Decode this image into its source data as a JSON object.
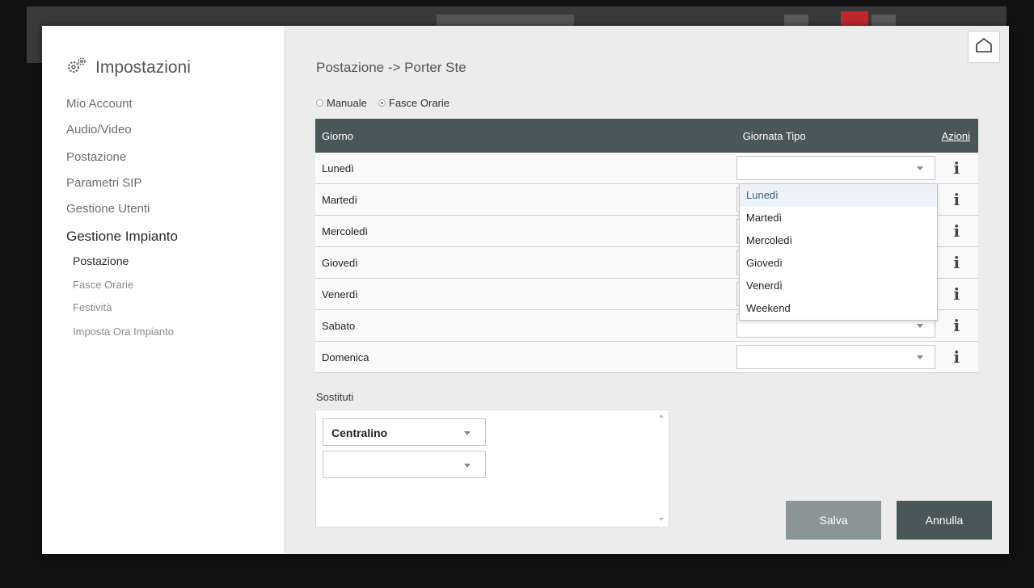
{
  "sidebar": {
    "title": "Impostazioni",
    "items": [
      {
        "label": "Mio Account"
      },
      {
        "label": "Audio/Video"
      },
      {
        "label": "Postazione"
      },
      {
        "label": "Parametri SIP"
      },
      {
        "label": "Gestione Utenti"
      },
      {
        "label": "Gestione Impianto"
      }
    ],
    "subitems": [
      {
        "label": "Postazione"
      },
      {
        "label": "Fasce Orarie"
      },
      {
        "label": "Festività"
      },
      {
        "label": "Imposta Ora Impianto"
      }
    ]
  },
  "main": {
    "title": "Postazione -> Porter Ste",
    "mode_options": [
      "Manuale",
      "Fasce Orarie"
    ],
    "selected_mode": "Fasce Orarie",
    "table": {
      "headers": {
        "giorno": "Giorno",
        "tipo": "Giornata Tipo",
        "azioni": "Azioni"
      },
      "rows": [
        {
          "day": "Lunedì",
          "tipo": ""
        },
        {
          "day": "Martedì",
          "tipo": ""
        },
        {
          "day": "Mercoledì",
          "tipo": ""
        },
        {
          "day": "Giovedì",
          "tipo": ""
        },
        {
          "day": "Venerdì",
          "tipo": ""
        },
        {
          "day": "Sabato",
          "tipo": ""
        },
        {
          "day": "Domenica",
          "tipo": ""
        }
      ],
      "info_symbol": "i"
    },
    "dropdown_options": [
      "Lunedì",
      "Martedì",
      "Mercoledì",
      "Giovedì",
      "Venerdì",
      "Weekend"
    ],
    "dropdown_highlighted": "Lunedì",
    "sostituti": {
      "label": "Sostituti",
      "selects": [
        {
          "value": "Centralino"
        },
        {
          "value": ""
        }
      ]
    },
    "buttons": {
      "salva": "Salva",
      "annulla": "Annulla"
    }
  },
  "colors": {
    "header_bg": "#4a5758",
    "salva_bg": "#8a9596",
    "annulla_bg": "#4a5758",
    "alert_red": "#c0272d"
  }
}
